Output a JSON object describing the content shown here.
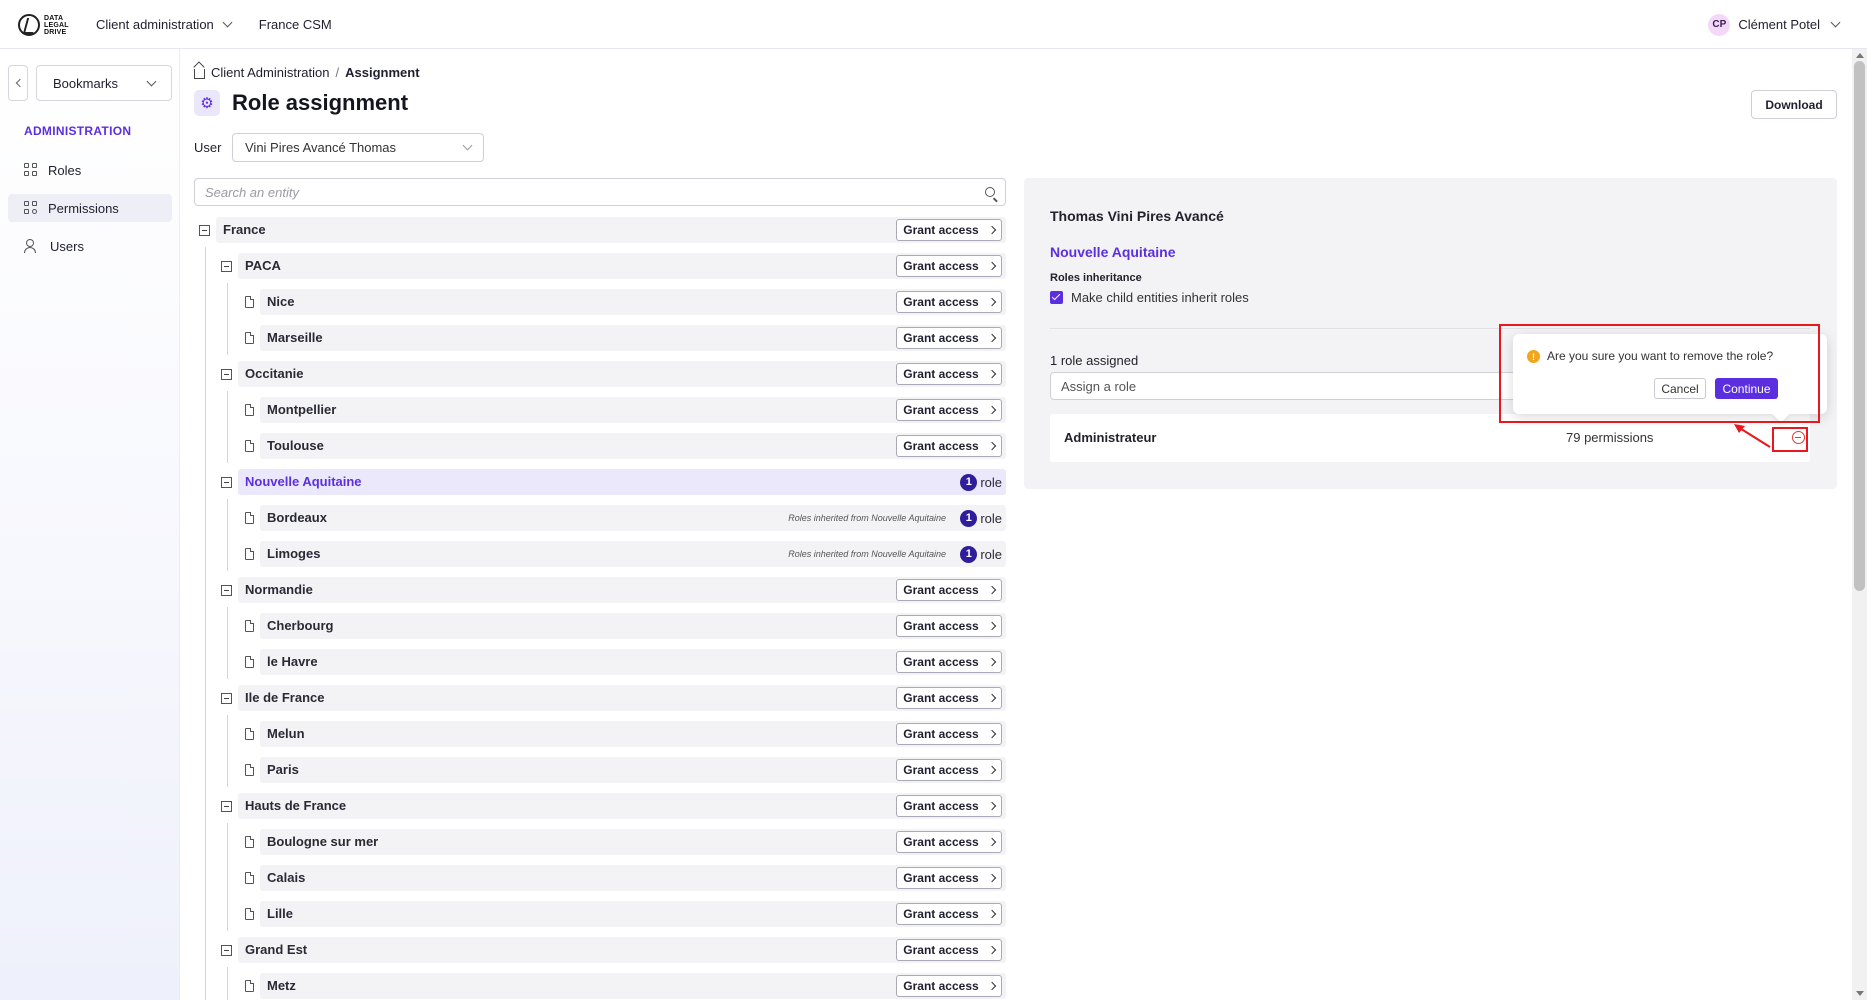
{
  "topbar": {
    "logo_text": [
      "DATA",
      "LEGAL",
      "DRIVE"
    ],
    "menu": [
      {
        "label": "Client administration",
        "has_dropdown": true
      },
      {
        "label": "France CSM",
        "has_dropdown": false
      }
    ],
    "user": {
      "initials": "CP",
      "name": "Clément Potel"
    }
  },
  "sidebar": {
    "bookmarks_label": "Bookmarks",
    "section_title": "ADMINISTRATION",
    "items": [
      {
        "label": "Roles",
        "icon": "grid-icon",
        "active": false
      },
      {
        "label": "Permissions",
        "icon": "grid-plus-icon",
        "active": true
      },
      {
        "label": "Users",
        "icon": "users-icon",
        "active": false
      }
    ]
  },
  "header": {
    "breadcrumb": {
      "root": "Client Administration",
      "separator": "/",
      "current": "Assignment"
    },
    "title": "Role assignment",
    "download_label": "Download",
    "user_label": "User",
    "user_selected": "Vini Pires Avancé Thomas"
  },
  "search": {
    "placeholder": "Search an entity"
  },
  "tree": {
    "grant_label": "Grant access",
    "role_suffix": "role",
    "rows": [
      {
        "label": "France",
        "level": 0,
        "type": "folder"
      },
      {
        "label": "PACA",
        "level": 1,
        "type": "folder"
      },
      {
        "label": "Nice",
        "level": 2,
        "type": "file"
      },
      {
        "label": "Marseille",
        "level": 2,
        "type": "file"
      },
      {
        "label": "Occitanie",
        "level": 1,
        "type": "folder"
      },
      {
        "label": "Montpellier",
        "level": 2,
        "type": "file"
      },
      {
        "label": "Toulouse",
        "level": 2,
        "type": "file"
      },
      {
        "label": "Nouvelle Aquitaine",
        "level": 1,
        "type": "folder",
        "selected": true,
        "roles": "1"
      },
      {
        "label": "Bordeaux",
        "level": 2,
        "type": "file",
        "roles": "1",
        "note": "Roles inherited from Nouvelle Aquitaine"
      },
      {
        "label": "Limoges",
        "level": 2,
        "type": "file",
        "roles": "1",
        "note": "Roles inherited from Nouvelle Aquitaine"
      },
      {
        "label": "Normandie",
        "level": 1,
        "type": "folder"
      },
      {
        "label": "Cherbourg",
        "level": 2,
        "type": "file"
      },
      {
        "label": "le Havre",
        "level": 2,
        "type": "file"
      },
      {
        "label": "Ile de France",
        "level": 1,
        "type": "folder"
      },
      {
        "label": "Melun",
        "level": 2,
        "type": "file"
      },
      {
        "label": "Paris",
        "level": 2,
        "type": "file"
      },
      {
        "label": "Hauts de France",
        "level": 1,
        "type": "folder"
      },
      {
        "label": "Boulogne sur mer",
        "level": 2,
        "type": "file"
      },
      {
        "label": "Calais",
        "level": 2,
        "type": "file"
      },
      {
        "label": "Lille",
        "level": 2,
        "type": "file"
      },
      {
        "label": "Grand Est",
        "level": 1,
        "type": "folder"
      },
      {
        "label": "Metz",
        "level": 2,
        "type": "file"
      }
    ]
  },
  "panel": {
    "user_name": "Thomas Vini Pires Avancé",
    "entity": "Nouvelle Aquitaine",
    "inheritance_title": "Roles inheritance",
    "inheritance_checkbox": "Make child entities inherit roles",
    "inheritance_checked": true,
    "assigned_count": "1 role assigned",
    "assign_placeholder": "Assign a role",
    "role": {
      "name": "Administrateur",
      "permissions": "79 permissions"
    }
  },
  "popconfirm": {
    "message": "Are you sure you want to remove the role?",
    "cancel_label": "Cancel",
    "continue_label": "Continue"
  },
  "colors": {
    "accent": "#5b2fe0",
    "badge": "#2f1e9c",
    "annotation": "#e8191e",
    "warning": "#f2a61c"
  }
}
